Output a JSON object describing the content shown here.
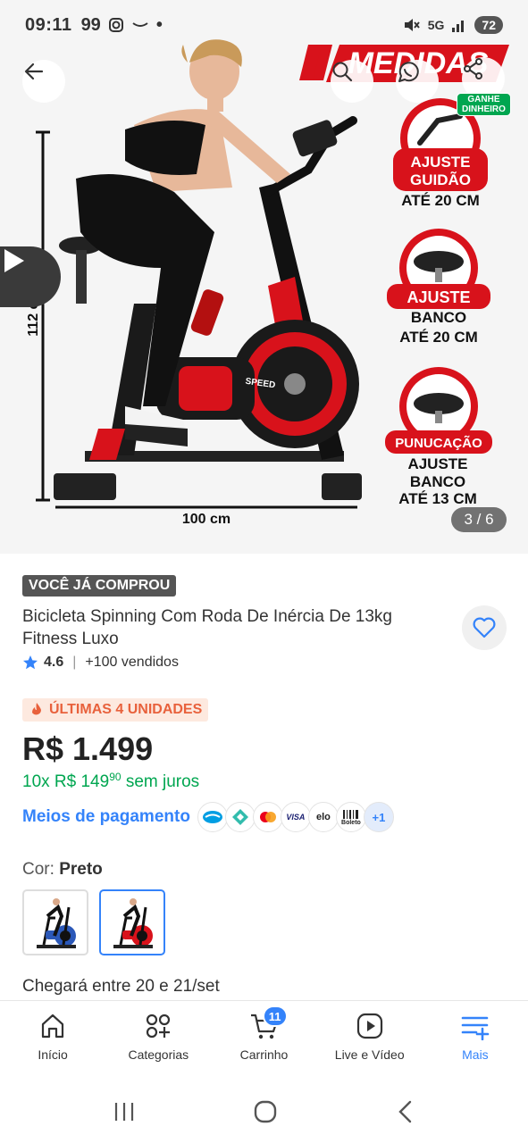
{
  "status_bar": {
    "time": "09:11",
    "extra": "99",
    "network": "5G",
    "battery": "72"
  },
  "gallery": {
    "counter": "3 / 6",
    "ganhe_label_line1": "GANHE",
    "ganhe_label_line2": "DINHEIRO",
    "image_texts": {
      "banner": "MEDIDAS",
      "height": "112 cm",
      "width": "100 cm",
      "speed": "SPEED",
      "f1_l1": "AJUSTE",
      "f1_l2": "GUIDÃO",
      "f1_l3": "ATÉ 20 CM",
      "f2_l1": "AJUSTE",
      "f2_l2": "BANCO",
      "f2_l3": "ATÉ 20 CM",
      "f3_l1": "PUNUCAÇÃO",
      "f3_l2": "AJUSTE",
      "f3_l3": "BANCO",
      "f3_l4": "ATÉ 13 CM"
    }
  },
  "product": {
    "badge": "VOCÊ JÁ COMPROU",
    "title": "Bicicleta Spinning Com Roda De Inércia De 13kg Fitness Luxo",
    "rating": "4.6",
    "sold": "+100 vendidos",
    "stock_badge": "ÚLTIMAS 4 UNIDADES",
    "price": "R$ 1.499",
    "installments_prefix": "10x R$ 149",
    "installments_cents": "90",
    "installments_suffix": "sem juros",
    "payment_link": "Meios de pagamento",
    "payment_more": "+1",
    "payment_visa": "VISA",
    "payment_elo": "elo",
    "payment_boleto": "Boleto",
    "color_label": "Cor:",
    "color_value": "Preto",
    "delivery": "Chegará entre 20 e 21/set"
  },
  "bottom_nav": {
    "items": [
      {
        "label": "Início",
        "icon": "home-icon"
      },
      {
        "label": "Categorias",
        "icon": "categories-icon"
      },
      {
        "label": "Carrinho",
        "icon": "cart-icon",
        "badge": "11"
      },
      {
        "label": "Live e Vídeo",
        "icon": "play-icon"
      },
      {
        "label": "Mais",
        "icon": "menu-icon"
      }
    ]
  },
  "colors": {
    "accent": "#3483fa",
    "green": "#00a650",
    "red": "#d8121b",
    "stock_orange": "#e8613c"
  }
}
